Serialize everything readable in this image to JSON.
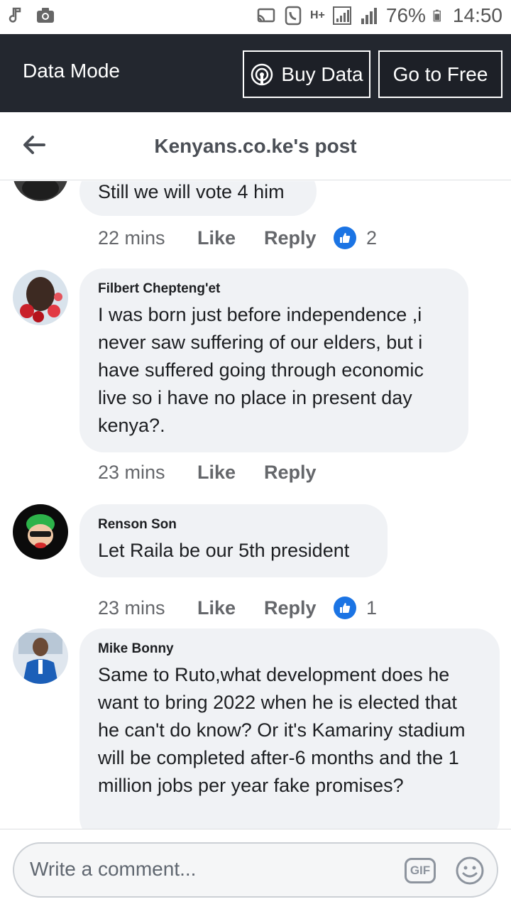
{
  "status_bar": {
    "battery": "76%",
    "time": "14:50",
    "network": "H+"
  },
  "data_mode": {
    "label": "Data Mode",
    "buy_data": "Buy Data",
    "go_to_free": "Go to Free"
  },
  "header": {
    "title": "Kenyans.co.ke's post"
  },
  "comments": [
    {
      "author": "",
      "text": "Still we will vote 4 him",
      "time": "22 mins",
      "like": "Like",
      "reply": "Reply",
      "reactions": "2"
    },
    {
      "author": "Filbert Chepteng'et",
      "text": "I was born just before independence ,i never saw suffering of our elders, but i have suffered going through economic live so i have no place in present day kenya?.",
      "time": "23 mins",
      "like": "Like",
      "reply": "Reply",
      "reactions": ""
    },
    {
      "author": "Renson Son",
      "text": "Let Raila be our 5th president",
      "time": "23 mins",
      "like": "Like",
      "reply": "Reply",
      "reactions": "1"
    },
    {
      "author": "Mike Bonny",
      "text": "Same to Ruto,what development does he want to bring 2022 when he is elected that he can't do know? Or it's Kamariny stadium will be completed after-6 months and the 1 million jobs per year fake promises?",
      "time": "",
      "like": "",
      "reply": "",
      "reactions": ""
    }
  ],
  "composer": {
    "placeholder": "Write a comment...",
    "gif": "GIF"
  },
  "colors": {
    "data_mode_bg": "#23272f",
    "like_blue": "#1b74e4",
    "bubble_bg": "#f0f2f5"
  }
}
